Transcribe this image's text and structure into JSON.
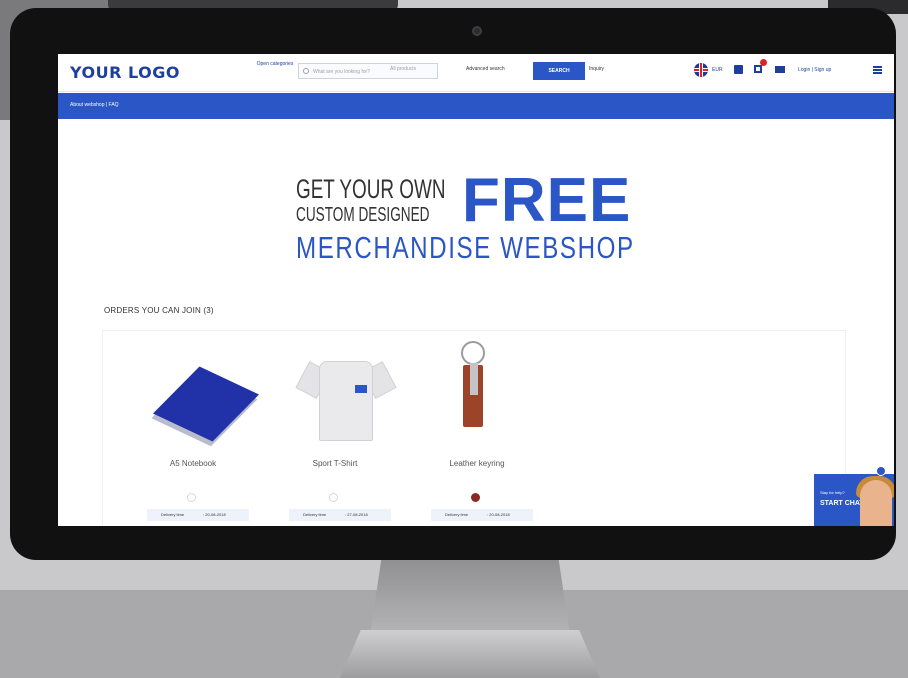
{
  "header": {
    "logo": "YOUR LOGO",
    "open_categories": "Open categories",
    "search_placeholder": "What are you looking for?",
    "category_placeholder": "All products",
    "advanced_search": "Advanced search",
    "search_button": "SEARCH",
    "inquiry": "Inquiry",
    "language": "EUR",
    "login": "Login | Sign up"
  },
  "nav": {
    "links": "About webshop  |  FAQ"
  },
  "hero": {
    "line1": "GET YOUR OWN",
    "line2": "CUSTOM DESIGNED",
    "free": "FREE",
    "line3": "MERCHANDISE WEBSHOP"
  },
  "orders": {
    "title": "ORDERS YOU CAN JOIN (3)",
    "products": [
      {
        "name": "A5 Notebook",
        "delivery_label": "Delivery time",
        "delivery_value": ": 20-08-2018",
        "swatch": "#ffffff"
      },
      {
        "name": "Sport T-Shirt",
        "delivery_label": "Delivery time",
        "delivery_value": ": 27-08-2018",
        "swatch": "#ffffff"
      },
      {
        "name": "Leather keyring",
        "delivery_label": "Delivery time",
        "delivery_value": ": 20-08-2018",
        "swatch": "#8b2a1e"
      }
    ]
  },
  "chat": {
    "prompt": "Stay for help?",
    "button": "START CHAT"
  },
  "colors": {
    "brand_blue": "#2a56c6",
    "logo_blue": "#1f3f9e"
  }
}
